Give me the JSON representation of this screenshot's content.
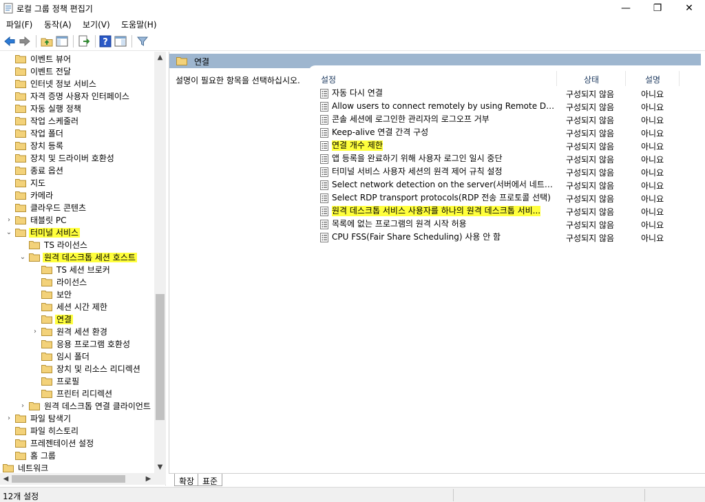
{
  "window": {
    "title": "로컬 그룹 정책 편집기",
    "minimize": "—",
    "maximize": "❐",
    "close": "✕"
  },
  "menu": [
    "파일(F)",
    "동작(A)",
    "보기(V)",
    "도움말(H)"
  ],
  "tree": {
    "items": [
      {
        "label": "이벤트 뷰어",
        "level": 1,
        "expander": "",
        "highlight": false
      },
      {
        "label": "이벤트 전달",
        "level": 1,
        "expander": "",
        "highlight": false
      },
      {
        "label": "인터넷 정보 서비스",
        "level": 1,
        "expander": "",
        "highlight": false
      },
      {
        "label": "자격 증명 사용자 인터페이스",
        "level": 1,
        "expander": "",
        "highlight": false
      },
      {
        "label": "자동 실행 정책",
        "level": 1,
        "expander": "",
        "highlight": false
      },
      {
        "label": "작업 스케줄러",
        "level": 1,
        "expander": "",
        "highlight": false
      },
      {
        "label": "작업 폴더",
        "level": 1,
        "expander": "",
        "highlight": false
      },
      {
        "label": "장치 등록",
        "level": 1,
        "expander": "",
        "highlight": false
      },
      {
        "label": "장치 및 드라이버 호환성",
        "level": 1,
        "expander": "",
        "highlight": false
      },
      {
        "label": "종료 옵션",
        "level": 1,
        "expander": "",
        "highlight": false
      },
      {
        "label": "지도",
        "level": 1,
        "expander": "",
        "highlight": false
      },
      {
        "label": "카메라",
        "level": 1,
        "expander": "",
        "highlight": false
      },
      {
        "label": "클라우드 콘텐츠",
        "level": 1,
        "expander": "",
        "highlight": false
      },
      {
        "label": "태블릿 PC",
        "level": 1,
        "expander": "›",
        "highlight": false
      },
      {
        "label": "터미널 서비스",
        "level": 1,
        "expander": "⌄",
        "highlight": true
      },
      {
        "label": "TS 라이선스",
        "level": 2,
        "expander": "",
        "highlight": false
      },
      {
        "label": "원격 데스크톱 세션 호스트",
        "level": 2,
        "expander": "⌄",
        "highlight": true
      },
      {
        "label": "TS 세션 브로커",
        "level": 3,
        "expander": "",
        "highlight": false
      },
      {
        "label": "라이선스",
        "level": 3,
        "expander": "",
        "highlight": false
      },
      {
        "label": "보안",
        "level": 3,
        "expander": "",
        "highlight": false
      },
      {
        "label": "세션 시간 제한",
        "level": 3,
        "expander": "",
        "highlight": false
      },
      {
        "label": "연결",
        "level": 3,
        "expander": "",
        "highlight": true
      },
      {
        "label": "원격 세션 환경",
        "level": 3,
        "expander": "›",
        "highlight": false
      },
      {
        "label": "응용 프로그램 호환성",
        "level": 3,
        "expander": "",
        "highlight": false
      },
      {
        "label": "임시 폴더",
        "level": 3,
        "expander": "",
        "highlight": false
      },
      {
        "label": "장치 및 리소스 리디렉션",
        "level": 3,
        "expander": "",
        "highlight": false
      },
      {
        "label": "프로필",
        "level": 3,
        "expander": "",
        "highlight": false
      },
      {
        "label": "프린터 리디렉션",
        "level": 3,
        "expander": "",
        "highlight": false
      },
      {
        "label": "원격 데스크톱 연결 클라이언트",
        "level": 2,
        "expander": "›",
        "highlight": false
      },
      {
        "label": "파일 탐색기",
        "level": 1,
        "expander": "›",
        "highlight": false
      },
      {
        "label": "파일 히스토리",
        "level": 1,
        "expander": "",
        "highlight": false
      },
      {
        "label": "프레젠테이션 설정",
        "level": 1,
        "expander": "",
        "highlight": false
      },
      {
        "label": "홈 그룹",
        "level": 1,
        "expander": "",
        "highlight": false
      },
      {
        "label": "네트워크",
        "level": 0,
        "expander": "",
        "highlight": false
      }
    ]
  },
  "right": {
    "header": "연결",
    "description": "설명이 필요한 항목을 선택하십시오.",
    "columns": {
      "setting": "설정",
      "state": "상태",
      "comment": "설명"
    },
    "rows": [
      {
        "name": "자동 다시 연결",
        "state": "구성되지 않음",
        "comment": "아니요",
        "highlight": false
      },
      {
        "name": "Allow users to connect remotely by using Remote Desktop...",
        "state": "구성되지 않음",
        "comment": "아니요",
        "highlight": false
      },
      {
        "name": "콘솔 세션에 로그인한 관리자의 로그오프 거부",
        "state": "구성되지 않음",
        "comment": "아니요",
        "highlight": false
      },
      {
        "name": "Keep-alive 연결 간격 구성",
        "state": "구성되지 않음",
        "comment": "아니요",
        "highlight": false
      },
      {
        "name": "연결 개수 제한",
        "state": "구성되지 않음",
        "comment": "아니요",
        "highlight": true
      },
      {
        "name": "앱 등록을 완료하기 위해 사용자 로그인 일시 중단",
        "state": "구성되지 않음",
        "comment": "아니요",
        "highlight": false
      },
      {
        "name": "터미널 서비스 사용자 세션의 원격 제어 규칙 설정",
        "state": "구성되지 않음",
        "comment": "아니요",
        "highlight": false
      },
      {
        "name": "Select network detection on the server(서버에서 네트워크 ...",
        "state": "구성되지 않음",
        "comment": "아니요",
        "highlight": false
      },
      {
        "name": "Select RDP transport protocols(RDP 전송 프로토콜 선택)",
        "state": "구성되지 않음",
        "comment": "아니요",
        "highlight": false
      },
      {
        "name": "원격 데스크톱 서비스 사용자를 하나의 원격 데스크톱 서비...",
        "state": "구성되지 않음",
        "comment": "아니요",
        "highlight": true
      },
      {
        "name": "목록에 없는 프로그램의 원격 시작 허용",
        "state": "구성되지 않음",
        "comment": "아니요",
        "highlight": false
      },
      {
        "name": "CPU FSS(Fair Share Scheduling) 사용 안 함",
        "state": "구성되지 않음",
        "comment": "아니요",
        "highlight": false
      }
    ]
  },
  "tabs": [
    "확장",
    "표준"
  ],
  "status": "12개 설정",
  "colors": {
    "header": "#9eb6cf",
    "highlight": "#ffff3c",
    "folder": "#f3d27a"
  }
}
